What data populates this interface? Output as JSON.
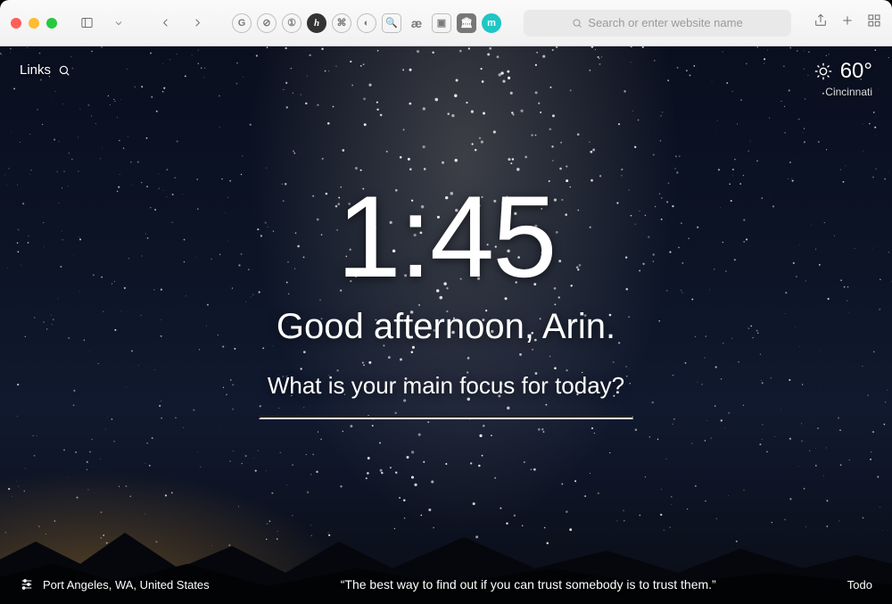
{
  "toolbar": {
    "address_placeholder": "Search or enter website name"
  },
  "page": {
    "links_label": "Links",
    "weather": {
      "temp": "60°",
      "city": "Cincinnati"
    },
    "clock": "1:45",
    "greeting": "Good afternoon, Arin.",
    "focus_prompt": "What is your main focus for today?",
    "location": "Port Angeles, WA, United States",
    "quote": "“The best way to find out if you can trust somebody is to trust them.”",
    "todo_label": "Todo"
  }
}
